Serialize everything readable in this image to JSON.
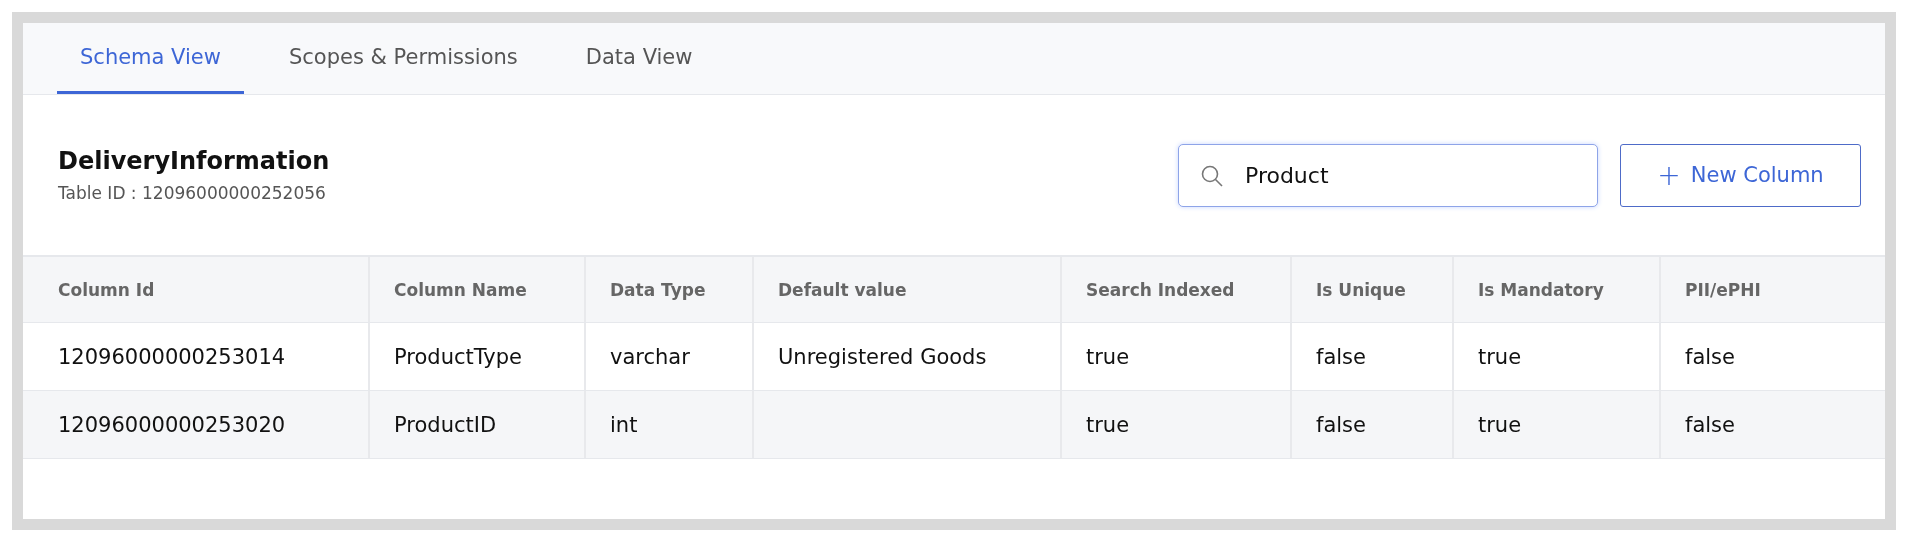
{
  "tabs": [
    {
      "label": "Schema View",
      "selected": true
    },
    {
      "label": "Scopes & Permissions",
      "selected": false
    },
    {
      "label": "Data View",
      "selected": false
    }
  ],
  "table_info": {
    "name": "DeliveryInformation",
    "table_id": "Table ID : 12096000000252056"
  },
  "search": {
    "value": "Product"
  },
  "new_column_button": {
    "icon": "+",
    "label": "New Column"
  },
  "table": {
    "columns": [
      "Column Id",
      "Column Name",
      "Data Type",
      "Default value",
      "Search Indexed",
      "Is Unique",
      "Is Mandatory",
      "PII/ePHI"
    ],
    "rows": [
      [
        "12096000000253014",
        "ProductType",
        "varchar",
        "Unregistered Goods",
        "true",
        "false",
        "true",
        "false"
      ],
      [
        "12096000000253020",
        "ProductID",
        "int",
        null,
        "true",
        "false",
        "true",
        "false"
      ]
    ]
  }
}
